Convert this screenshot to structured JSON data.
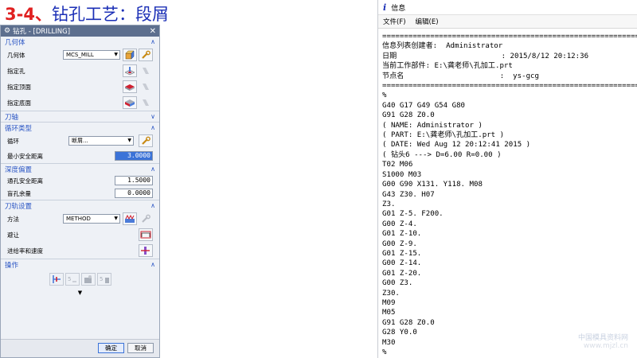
{
  "slide": {
    "title_num": "3-4、",
    "title_main": "钻孔工艺：",
    "title_sub": "段屑"
  },
  "dialog": {
    "title": "钻孔 - [DRILLING]",
    "geometry": {
      "header": "几何体",
      "geom_label": "几何体",
      "geom_value": "MCS_MILL",
      "hole_label": "指定孔",
      "top_label": "指定顶面",
      "bottom_label": "指定底面"
    },
    "tool_axis": {
      "header": "刀轴"
    },
    "cycle": {
      "header": "循环类型",
      "cycle_label": "循环",
      "cycle_value": "断屑...",
      "min_clearance_label": "最小安全距离",
      "min_clearance_value": "3.0000"
    },
    "depth": {
      "header": "深度偏置",
      "through_clearance_label": "通孔安全距离",
      "through_clearance_value": "1.5000",
      "blind_stock_label": "盲孔余量",
      "blind_stock_value": "0.0000"
    },
    "path": {
      "header": "刀轨设置",
      "method_label": "方法",
      "method_value": "METHOD",
      "avoid_label": "避让",
      "feeds_label": "进给率和速度"
    },
    "actions": {
      "header": "操作"
    },
    "ok_label": "确定",
    "cancel_label": "取消"
  },
  "info_window": {
    "title": "信息",
    "menu": [
      "文件(F)",
      "编辑(E)"
    ],
    "text": "============================================================\n信息列表创建者:  Administrator\n日期                        : 2015/8/12 20:12:36\n当前工作部件: E:\\龚老师\\孔加工.prt\n节点名                      :  ys-gcg\n============================================================\n%\nG40 G17 G49 G54 G80\nG91 G28 Z0.0\n( NAME: Administrator )\n( PART: E:\\龚老师\\孔加工.prt )\n( DATE: Wed Aug 12 20:12:41 2015 )\n( 钻头6 ---> D=6.00 R=0.00 )\nT02 M06\nS1000 M03\nG00 G90 X131. Y118. M08\nG43 Z30. H07\nZ3.\nG01 Z-5. F200.\nG00 Z-4.\nG01 Z-10.\nG00 Z-9.\nG01 Z-15.\nG00 Z-14.\nG01 Z-20.\nG00 Z3.\nZ30.\nM09\nM05\nG91 G28 Z0.0\nG28 Y0.0\nM30\n%"
  },
  "watermark": {
    "line1": "中国模具资料网",
    "line2": "www.mjzl.cn"
  }
}
